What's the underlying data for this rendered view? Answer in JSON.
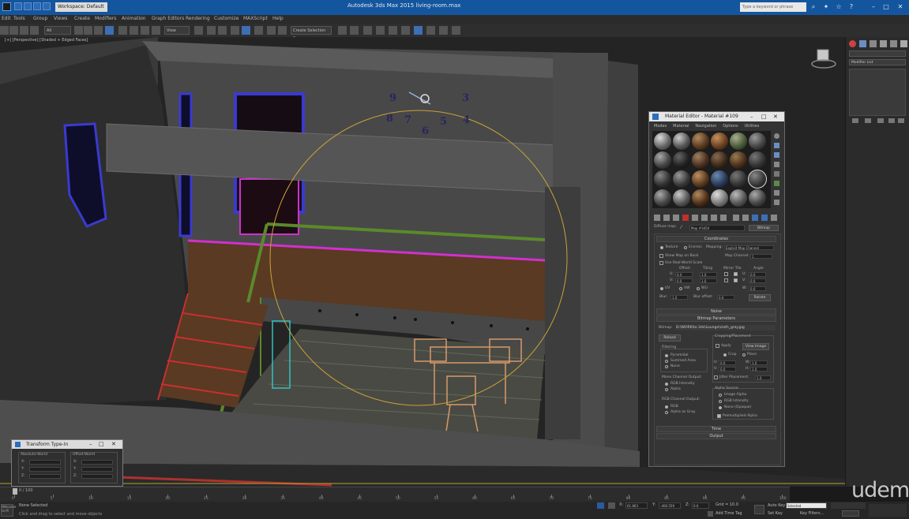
{
  "title_bar": {
    "title": "Autodesk 3ds Max 2015     living-room.max",
    "workspace": "Workspace: Default",
    "search_placeholder": "Type a keyword or phrase",
    "accent": "#14569e"
  },
  "menu": [
    "Edit",
    "Tools",
    "Group",
    "Views",
    "Create",
    "Modifiers",
    "Animation",
    "Graph Editors",
    "Rendering",
    "Customize",
    "MAXScript",
    "Help"
  ],
  "toolbar": {
    "selection_filter": "All",
    "ref_coord": "View",
    "named_selection": "Create Selection Se"
  },
  "viewport": {
    "label": "[+] [Perspective] [Shaded + Edged Faces]",
    "clock_numbers": [
      "9",
      "3",
      "8",
      "7",
      "5",
      "4",
      "6"
    ]
  },
  "command_panel": {
    "modifier_list": "Modifier List"
  },
  "material_editor": {
    "title": "Material Editor - Material #109",
    "menu": [
      "Modes",
      "Material",
      "Navigation",
      "Options",
      "Utilities"
    ],
    "map_label": "Diffuse map:",
    "map_name": "Map #3450",
    "map_type": "Bitmap",
    "rollouts": {
      "coordinates": "Coordinates",
      "noise": "Noise",
      "bitmap_params": "Bitmap Parameters",
      "time": "Time",
      "output": "Output"
    },
    "coords": {
      "texture": "Texture",
      "environ": "Environ",
      "mapping_label": "Mapping:",
      "mapping_value": "Explicit Map Channel",
      "show_map": "Show Map on Back",
      "map_channel_label": "Map Channel:",
      "map_channel": "1",
      "real_world": "Use Real-World Scale",
      "offset": "Offset",
      "tiling": "Tiling",
      "mirror_tile": "Mirror Tile",
      "angle": "Angle",
      "u": "U:",
      "v": "V:",
      "w": "W:",
      "u_offset": "0.0",
      "v_offset": "0.0",
      "u_tiling": "1.0",
      "v_tiling": "1.0",
      "u_angle": "0.0",
      "v_angle": "0.0",
      "w_angle": "0.0",
      "uv": "UV",
      "vw": "VW",
      "wu": "WU",
      "blur_label": "Blur:",
      "blur": "1.0",
      "blur_offset_label": "Blur offset:",
      "blur_offset": "0.0",
      "rotate": "Rotate"
    },
    "bitmap": {
      "label": "Bitmap:",
      "path": "D:\\WORK\\to 3ds\\Lounge\\cloth_grey.jpg",
      "reload": "Reload",
      "cropping": "Cropping/Placement",
      "apply": "Apply",
      "view_image": "View Image",
      "crop": "Crop",
      "place": "Place",
      "u": "U:",
      "v": "V:",
      "w": "W:",
      "h": "H:",
      "crop_u": "0.0",
      "crop_v": "0.0",
      "crop_w": "1.0",
      "crop_h": "1.0",
      "jitter": "Jitter Placement:",
      "jitter_val": "1.0",
      "filtering": "Filtering",
      "pyramidal": "Pyramidal",
      "summed": "Summed Area",
      "none": "None",
      "mono_out": "Mono Channel Output:",
      "rgb_intensity": "RGB Intensity",
      "alpha": "Alpha",
      "rgb_out": "RGB Channel Output:",
      "rgb": "RGB",
      "alpha_as_gray": "Alpha as Gray",
      "alpha_source": "Alpha Source",
      "image_alpha": "Image Alpha",
      "rgb_intensity2": "RGB Intensity",
      "none_opaque": "None (Opaque)",
      "premult": "Premultiplied Alpha"
    }
  },
  "transform_typein": {
    "title": "Transform Type-In",
    "absolute": "Absolute:World",
    "offset": "Offset:World",
    "x": "X:",
    "y": "Y:",
    "z": "Z:"
  },
  "timeline": {
    "frame": "0 / 100",
    "ticks": [
      "0",
      "5",
      "10",
      "15",
      "20",
      "25",
      "30",
      "35",
      "40",
      "45",
      "50",
      "55",
      "60",
      "65",
      "70",
      "75",
      "80",
      "85",
      "90",
      "95",
      "100"
    ]
  },
  "status": {
    "selected": "None Selected",
    "prompt": "Click and drag to select and move objects",
    "x_label": "X:",
    "x_val": "61.863",
    "y_label": "Y:",
    "y_val": "-400.559",
    "z_label": "Z:",
    "z_val": "0.0",
    "grid": "Grid = 10.0",
    "add_time_tag": "Add Time Tag",
    "auto_key": "Auto Key",
    "selected_dd": "Selected",
    "set_key": "Set Key",
    "key_filters": "Key Filters...",
    "welcome": "Welcome to M"
  },
  "watermark": "udemy"
}
